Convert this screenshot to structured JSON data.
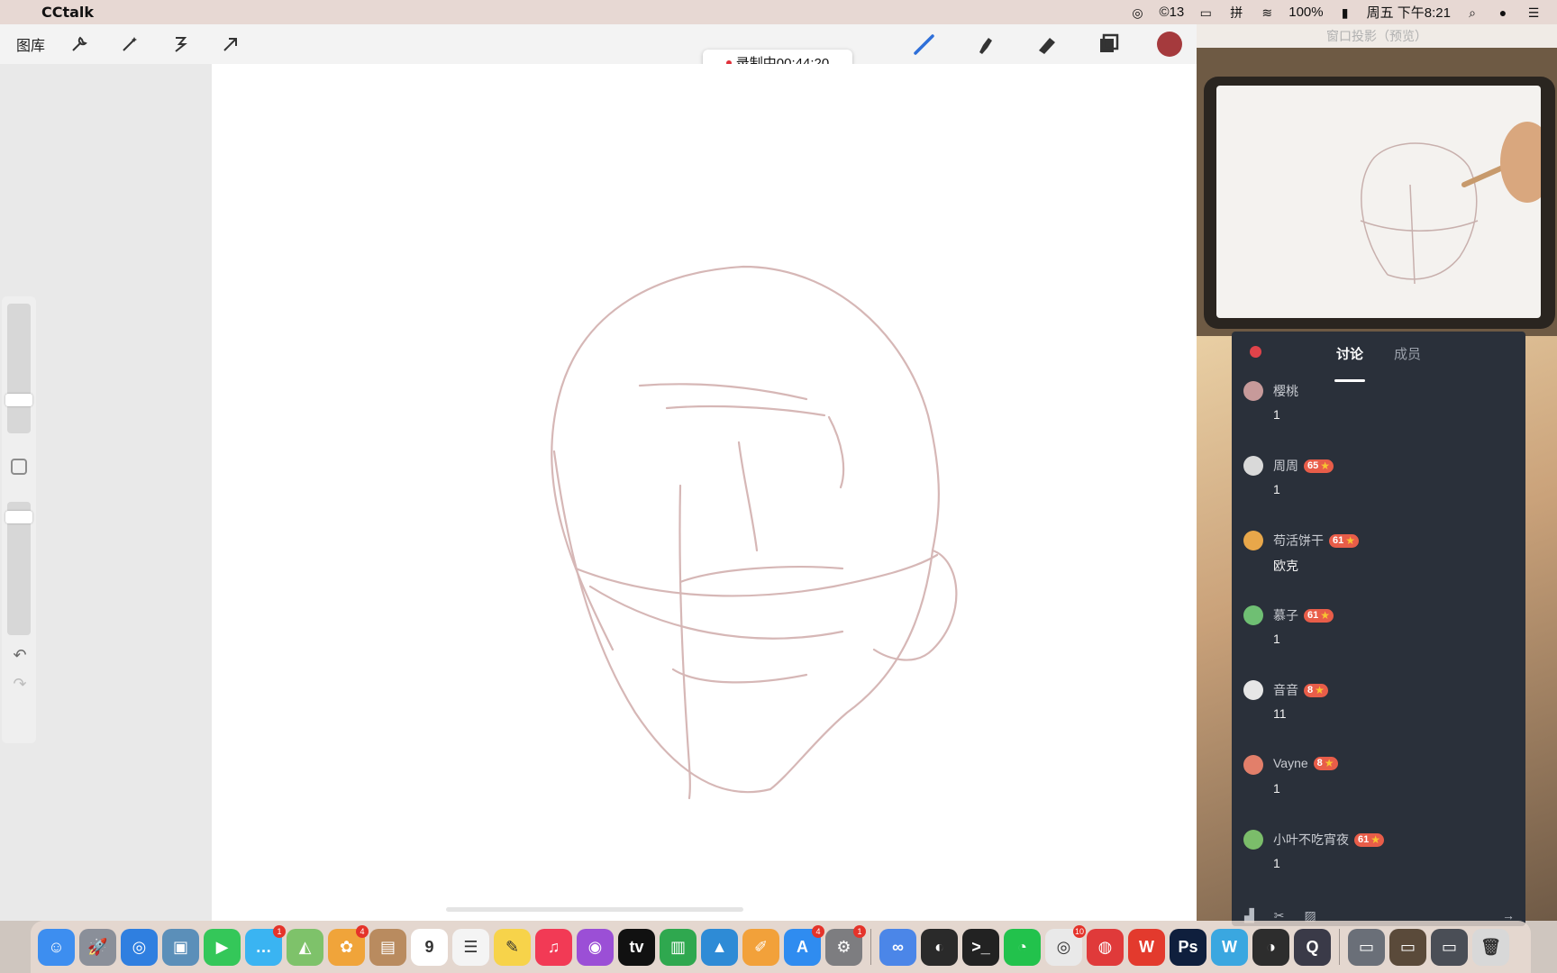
{
  "menubar": {
    "app_name": "CCtalk",
    "status_count": "13",
    "battery": "100%",
    "datetime": "周五 下午8:21"
  },
  "toolbar": {
    "gallery_label": "图库"
  },
  "recording": {
    "label": "录制中00:44:20"
  },
  "preview": {
    "title": "窗口投影（预览）"
  },
  "chat": {
    "tabs": [
      "讨论",
      "成员"
    ],
    "messages": [
      {
        "user": "樱桃",
        "badge": "",
        "text": "1",
        "avatar_color": "#c79a9a"
      },
      {
        "user": "周周",
        "badge": "65",
        "text": "1",
        "avatar_color": "#d9d9d9"
      },
      {
        "user": "苟活饼干",
        "badge": "61",
        "text": "欧克",
        "avatar_color": "#e8a74a"
      },
      {
        "user": "慕子",
        "badge": "61",
        "text": "1",
        "avatar_color": "#6fbf73"
      },
      {
        "user": "音音",
        "badge": "8",
        "text": "11",
        "avatar_color": "#e6e6e6"
      },
      {
        "user": "Vayne",
        "badge": "8",
        "text": "1",
        "avatar_color": "#e27f6a"
      },
      {
        "user": "小叶不吃宵夜",
        "badge": "61",
        "text": "1",
        "avatar_color": "#7bbd6a"
      }
    ]
  },
  "dock": {
    "apps": [
      {
        "name": "finder",
        "color": "#3d8ef0",
        "glyph": "☺",
        "badge": ""
      },
      {
        "name": "launchpad",
        "color": "#8a8f99",
        "glyph": "🚀",
        "badge": ""
      },
      {
        "name": "safari",
        "color": "#2f7fe0",
        "glyph": "◎",
        "badge": ""
      },
      {
        "name": "preview",
        "color": "#5b8fb9",
        "glyph": "▣",
        "badge": ""
      },
      {
        "name": "facetime",
        "color": "#34c759",
        "glyph": "▶",
        "badge": ""
      },
      {
        "name": "messages",
        "color": "#3ab4f2",
        "glyph": "…",
        "badge": "1"
      },
      {
        "name": "maps",
        "color": "#7ec26a",
        "glyph": "◭",
        "badge": ""
      },
      {
        "name": "photos",
        "color": "#f0a43a",
        "glyph": "✿",
        "badge": "4"
      },
      {
        "name": "contacts",
        "color": "#b98b5f",
        "glyph": "▤",
        "badge": ""
      },
      {
        "name": "calendar",
        "color": "#ffffff",
        "glyph": "9",
        "badge": ""
      },
      {
        "name": "reminders",
        "color": "#f4f4f4",
        "glyph": "☰",
        "badge": ""
      },
      {
        "name": "notes",
        "color": "#f7d34a",
        "glyph": "✎",
        "badge": ""
      },
      {
        "name": "music",
        "color": "#f23a55",
        "glyph": "♫",
        "badge": ""
      },
      {
        "name": "podcasts",
        "color": "#9b4fd6",
        "glyph": "◉",
        "badge": ""
      },
      {
        "name": "tv",
        "color": "#111111",
        "glyph": "tv",
        "badge": ""
      },
      {
        "name": "numbers",
        "color": "#2fa84f",
        "glyph": "▥",
        "badge": ""
      },
      {
        "name": "keynote",
        "color": "#2e8bd6",
        "glyph": "▲",
        "badge": ""
      },
      {
        "name": "pages",
        "color": "#f2a13a",
        "glyph": "✐",
        "badge": ""
      },
      {
        "name": "app-store",
        "color": "#2f8cf0",
        "glyph": "A",
        "badge": "4"
      },
      {
        "name": "system-preferences",
        "color": "#7d7d80",
        "glyph": "⚙",
        "badge": "1"
      },
      {
        "name": "baidu-netdisk",
        "color": "#4b86e8",
        "glyph": "∞",
        "badge": ""
      },
      {
        "name": "cpu-monitor",
        "color": "#2a2a2a",
        "glyph": "◐",
        "badge": ""
      },
      {
        "name": "terminal",
        "color": "#222222",
        "glyph": ">_",
        "badge": ""
      },
      {
        "name": "wechat",
        "color": "#22c24c",
        "glyph": "◔",
        "badge": ""
      },
      {
        "name": "chrome",
        "color": "#e9e9e9",
        "glyph": "◎",
        "badge": "10"
      },
      {
        "name": "netease-music",
        "color": "#e03a3a",
        "glyph": "◍",
        "badge": ""
      },
      {
        "name": "wps",
        "color": "#e33a2d",
        "glyph": "W",
        "badge": ""
      },
      {
        "name": "photoshop",
        "color": "#0f1f3d",
        "glyph": "Ps",
        "badge": ""
      },
      {
        "name": "word-app",
        "color": "#3aa7e0",
        "glyph": "W",
        "badge": ""
      },
      {
        "name": "obs",
        "color": "#2d2d2d",
        "glyph": "◑",
        "badge": ""
      },
      {
        "name": "quicktime",
        "color": "#3a3a48",
        "glyph": "Q",
        "badge": ""
      },
      {
        "name": "recent-window-1",
        "color": "#6a6f78",
        "glyph": "▭",
        "badge": ""
      },
      {
        "name": "recent-window-2",
        "color": "#5a4a3a",
        "glyph": "▭",
        "badge": ""
      },
      {
        "name": "recent-window-3",
        "color": "#4a4e56",
        "glyph": "▭",
        "badge": ""
      },
      {
        "name": "trash",
        "color": "#d8d8d8",
        "glyph": "🗑",
        "badge": ""
      }
    ]
  }
}
